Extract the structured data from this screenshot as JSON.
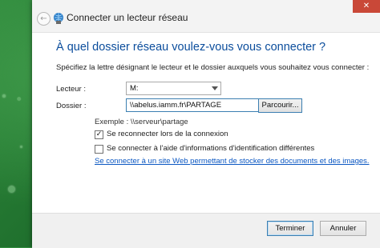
{
  "window": {
    "title": "Connecter un lecteur réseau",
    "close_glyph": "✕",
    "back_glyph": "←"
  },
  "content": {
    "heading": "À quel dossier réseau voulez-vous vous connecter ?",
    "instructions": "Spécifiez la lettre désignant le lecteur et le dossier auxquels vous souhaitez vous connecter :",
    "drive_label": "Lecteur :",
    "drive_value": "M:",
    "folder_label": "Dossier :",
    "folder_value": "\\\\abelus.iamm.fr\\PARTAGE",
    "browse_label": "Parcourir...",
    "example": "Exemple : \\\\serveur\\partage",
    "reconnect_label": "Se reconnecter lors de la connexion",
    "reconnect_checked": true,
    "other_credentials_label": "Se connecter à l'aide d'informations d'identification différentes",
    "other_credentials_checked": false,
    "website_link": "Se connecter à un site Web permettant de stocker des documents et des images."
  },
  "footer": {
    "finish_label": "Terminer",
    "cancel_label": "Annuler"
  },
  "colors": {
    "heading": "#0b4d9c",
    "link": "#0b57c2",
    "close": "#c94838"
  },
  "icons": [
    "back-arrow-icon",
    "network-drive-icon",
    "close-icon",
    "dropdown-caret-icon",
    "checkmark-icon"
  ]
}
